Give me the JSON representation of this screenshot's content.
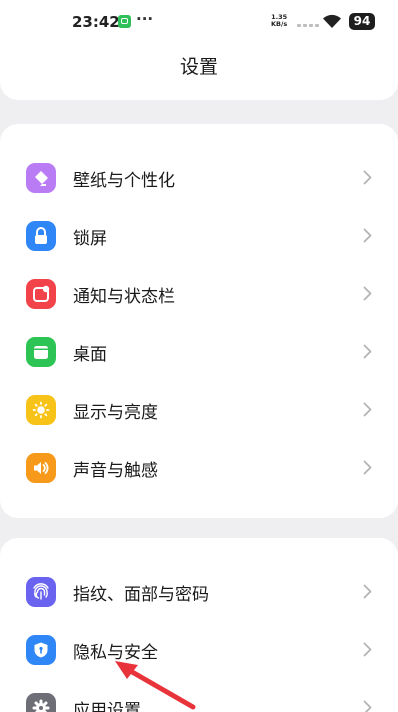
{
  "status_bar": {
    "time": "23:42",
    "dots": "···",
    "net_speed_value": "1.35",
    "net_speed_unit": "KB/s",
    "battery": "94",
    "icons": [
      "app-notification-icon",
      "signal-icon",
      "wifi-icon",
      "battery-icon"
    ]
  },
  "header": {
    "title": "设置"
  },
  "groups": [
    {
      "items": [
        {
          "label": "壁纸与个性化",
          "icon": "palette-icon",
          "color": "#b97cf5"
        },
        {
          "label": "锁屏",
          "icon": "lock-icon",
          "color": "#2f86f6"
        },
        {
          "label": "通知与状态栏",
          "icon": "notification-icon",
          "color": "#f2434a"
        },
        {
          "label": "桌面",
          "icon": "desktop-icon",
          "color": "#2cc454"
        },
        {
          "label": "显示与亮度",
          "icon": "brightness-icon",
          "color": "#f8c318"
        },
        {
          "label": "声音与触感",
          "icon": "sound-icon",
          "color": "#f79a1b"
        }
      ]
    },
    {
      "items": [
        {
          "label": "指纹、面部与密码",
          "icon": "fingerprint-icon",
          "color": "#6a63f0"
        },
        {
          "label": "隐私与安全",
          "icon": "shield-icon",
          "color": "#2f86f6"
        },
        {
          "label": "应用设置",
          "icon": "gear-icon",
          "color": "#6e6e76"
        }
      ]
    }
  ],
  "annotation": {
    "color": "#e8333a"
  }
}
